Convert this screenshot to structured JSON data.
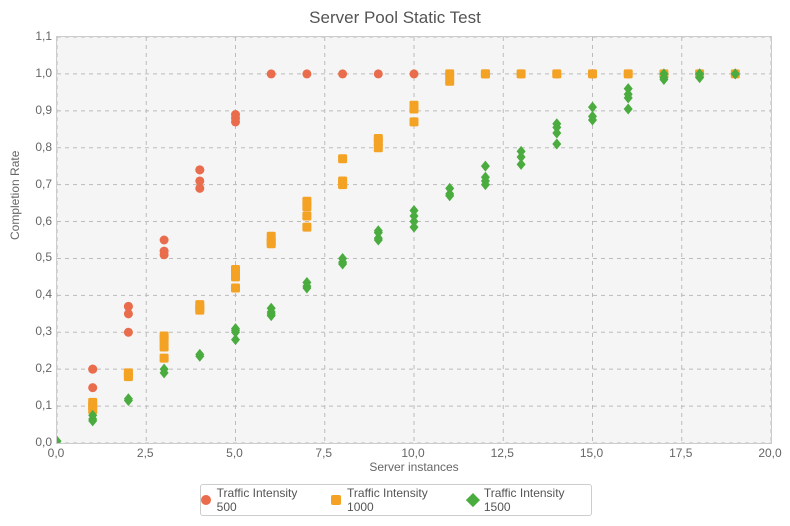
{
  "chart_data": {
    "type": "scatter",
    "title": "Server Pool Static Test",
    "xlabel": "Server instances",
    "ylabel": "Completion Rate",
    "xlim": [
      0,
      20
    ],
    "ylim": [
      0,
      1.1
    ],
    "xticks": [
      "0,0",
      "2,5",
      "5,0",
      "7,5",
      "10,0",
      "12,5",
      "15,0",
      "17,5",
      "20,0"
    ],
    "yticks": [
      "0,0",
      "0,1",
      "0,2",
      "0,3",
      "0,4",
      "0,5",
      "0,6",
      "0,7",
      "0,8",
      "0,9",
      "1,0",
      "1,1"
    ],
    "legend": [
      "Traffic Intensity 500",
      "Traffic Intensity 1000",
      "Traffic Intensity 1500"
    ],
    "series": [
      {
        "name": "Traffic Intensity 500",
        "color": "#e96d4c",
        "marker": "circle",
        "points": [
          [
            1,
            0.15
          ],
          [
            1,
            0.2
          ],
          [
            1,
            0.2
          ],
          [
            2,
            0.3
          ],
          [
            2,
            0.35
          ],
          [
            2,
            0.37
          ],
          [
            2,
            0.37
          ],
          [
            3,
            0.51
          ],
          [
            3,
            0.52
          ],
          [
            3,
            0.55
          ],
          [
            4,
            0.69
          ],
          [
            4,
            0.71
          ],
          [
            4,
            0.74
          ],
          [
            4,
            0.74
          ],
          [
            5,
            0.87
          ],
          [
            5,
            0.88
          ],
          [
            5,
            0.89
          ],
          [
            6,
            1.0
          ],
          [
            7,
            1.0
          ],
          [
            8,
            1.0
          ],
          [
            9,
            1.0
          ],
          [
            10,
            1.0
          ],
          [
            11,
            1.0
          ],
          [
            12,
            1.0
          ],
          [
            13,
            1.0
          ],
          [
            14,
            1.0
          ],
          [
            15,
            1.0
          ],
          [
            16,
            1.0
          ],
          [
            17,
            1.0
          ],
          [
            18,
            1.0
          ],
          [
            19,
            1.0
          ]
        ]
      },
      {
        "name": "Traffic Intensity 1000",
        "color": "#f4a224",
        "marker": "square",
        "points": [
          [
            1,
            0.09
          ],
          [
            1,
            0.1
          ],
          [
            1,
            0.11
          ],
          [
            2,
            0.18
          ],
          [
            2,
            0.185
          ],
          [
            2,
            0.19
          ],
          [
            3,
            0.23
          ],
          [
            3,
            0.26
          ],
          [
            3,
            0.28
          ],
          [
            3,
            0.29
          ],
          [
            4,
            0.36
          ],
          [
            4,
            0.365
          ],
          [
            4,
            0.375
          ],
          [
            5,
            0.42
          ],
          [
            5,
            0.45
          ],
          [
            5,
            0.465
          ],
          [
            5,
            0.47
          ],
          [
            6,
            0.54
          ],
          [
            6,
            0.545
          ],
          [
            6,
            0.56
          ],
          [
            7,
            0.585
          ],
          [
            7,
            0.615
          ],
          [
            7,
            0.64
          ],
          [
            7,
            0.655
          ],
          [
            8,
            0.7
          ],
          [
            8,
            0.71
          ],
          [
            8,
            0.77
          ],
          [
            9,
            0.8
          ],
          [
            9,
            0.815
          ],
          [
            9,
            0.825
          ],
          [
            10,
            0.87
          ],
          [
            10,
            0.905
          ],
          [
            10,
            0.915
          ],
          [
            11,
            0.98
          ],
          [
            11,
            1.0
          ],
          [
            12,
            1.0
          ],
          [
            12,
            1.0
          ],
          [
            13,
            1.0
          ],
          [
            14,
            1.0
          ],
          [
            15,
            1.0
          ],
          [
            16,
            1.0
          ],
          [
            17,
            1.0
          ],
          [
            18,
            1.0
          ],
          [
            19,
            1.0
          ]
        ]
      },
      {
        "name": "Traffic Intensity 1500",
        "color": "#4aab3e",
        "marker": "diamond",
        "points": [
          [
            0,
            0.005
          ],
          [
            1,
            0.06
          ],
          [
            1,
            0.065
          ],
          [
            1,
            0.075
          ],
          [
            2,
            0.115
          ],
          [
            2,
            0.12
          ],
          [
            3,
            0.19
          ],
          [
            3,
            0.2
          ],
          [
            4,
            0.235
          ],
          [
            4,
            0.24
          ],
          [
            5,
            0.28
          ],
          [
            5,
            0.3
          ],
          [
            5,
            0.305
          ],
          [
            5,
            0.31
          ],
          [
            6,
            0.345
          ],
          [
            6,
            0.35
          ],
          [
            6,
            0.355
          ],
          [
            6,
            0.365
          ],
          [
            7,
            0.42
          ],
          [
            7,
            0.425
          ],
          [
            7,
            0.435
          ],
          [
            8,
            0.485
          ],
          [
            8,
            0.49
          ],
          [
            8,
            0.5
          ],
          [
            9,
            0.55
          ],
          [
            9,
            0.555
          ],
          [
            9,
            0.57
          ],
          [
            9,
            0.575
          ],
          [
            10,
            0.585
          ],
          [
            10,
            0.6
          ],
          [
            10,
            0.615
          ],
          [
            10,
            0.63
          ],
          [
            11,
            0.67
          ],
          [
            11,
            0.675
          ],
          [
            11,
            0.69
          ],
          [
            12,
            0.7
          ],
          [
            12,
            0.71
          ],
          [
            12,
            0.72
          ],
          [
            12,
            0.75
          ],
          [
            13,
            0.755
          ],
          [
            13,
            0.775
          ],
          [
            13,
            0.79
          ],
          [
            14,
            0.81
          ],
          [
            14,
            0.84
          ],
          [
            14,
            0.855
          ],
          [
            14,
            0.865
          ],
          [
            15,
            0.875
          ],
          [
            15,
            0.885
          ],
          [
            15,
            0.91
          ],
          [
            16,
            0.905
          ],
          [
            16,
            0.935
          ],
          [
            16,
            0.945
          ],
          [
            16,
            0.96
          ],
          [
            17,
            0.985
          ],
          [
            17,
            0.99
          ],
          [
            17,
            1.0
          ],
          [
            18,
            0.99
          ],
          [
            18,
            1.0
          ],
          [
            18,
            1.0
          ],
          [
            19,
            1.0
          ],
          [
            19,
            1.0
          ]
        ]
      }
    ]
  }
}
